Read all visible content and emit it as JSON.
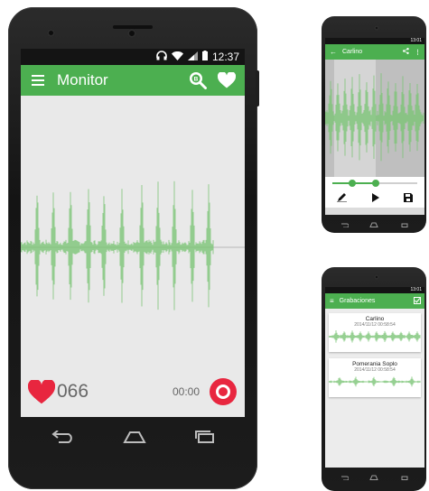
{
  "colors": {
    "accent": "#4caf50",
    "record": "#e8263f",
    "heart": "#e8263f",
    "waveform": "#7cc576"
  },
  "main": {
    "status_time": "12:37",
    "title": "Monitor",
    "counter": "066",
    "timer": "00:00",
    "icons": {
      "menu": "hamburger-menu-icon",
      "search": "search-icon",
      "favorite": "heart-icon",
      "record": "record-icon"
    }
  },
  "player": {
    "title": "Carlino",
    "status_time": "13:01"
  },
  "list": {
    "title": "Grabaciones",
    "status_time": "13:01",
    "items": [
      {
        "name": "Carlino",
        "date": "2014/11/12 00:58:54"
      },
      {
        "name": "Pomerania Soplo",
        "date": "2014/11/12 00:58:54"
      }
    ]
  }
}
